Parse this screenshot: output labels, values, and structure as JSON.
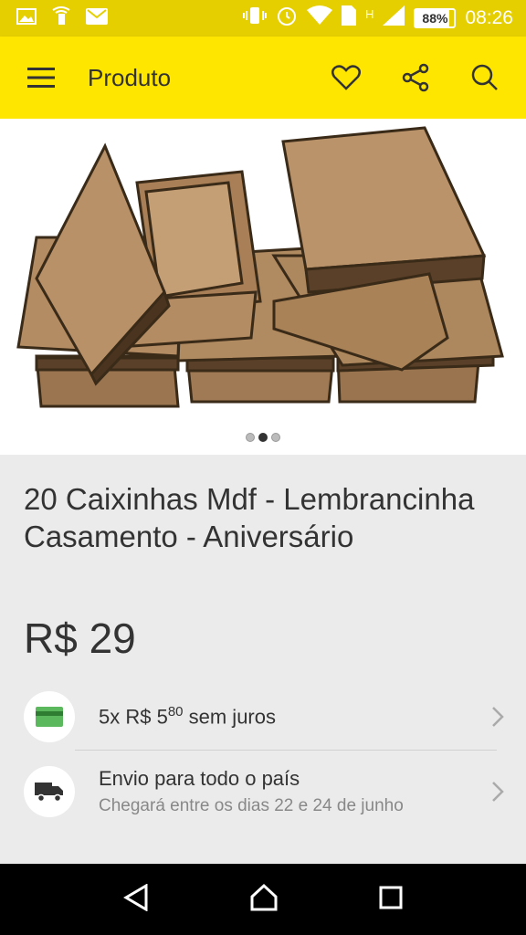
{
  "status_bar": {
    "time": "08:26",
    "battery": "88%",
    "network": "H"
  },
  "app_bar": {
    "title": "Produto"
  },
  "gallery": {
    "page_count": 3,
    "active_index": 1
  },
  "product": {
    "title": "20 Caixinhas Mdf - Lembrancinha Casamento - Aniversário",
    "price": "R$ 29"
  },
  "installments": {
    "prefix": "5x R$ 5",
    "cents": "80",
    "suffix": " sem juros"
  },
  "shipping": {
    "title": "Envio para todo o país",
    "subtitle": "Chegará entre os dias 22 e 24 de junho"
  },
  "colors": {
    "brand_yellow": "#ffe600",
    "status_yellow": "#e6cf00"
  }
}
